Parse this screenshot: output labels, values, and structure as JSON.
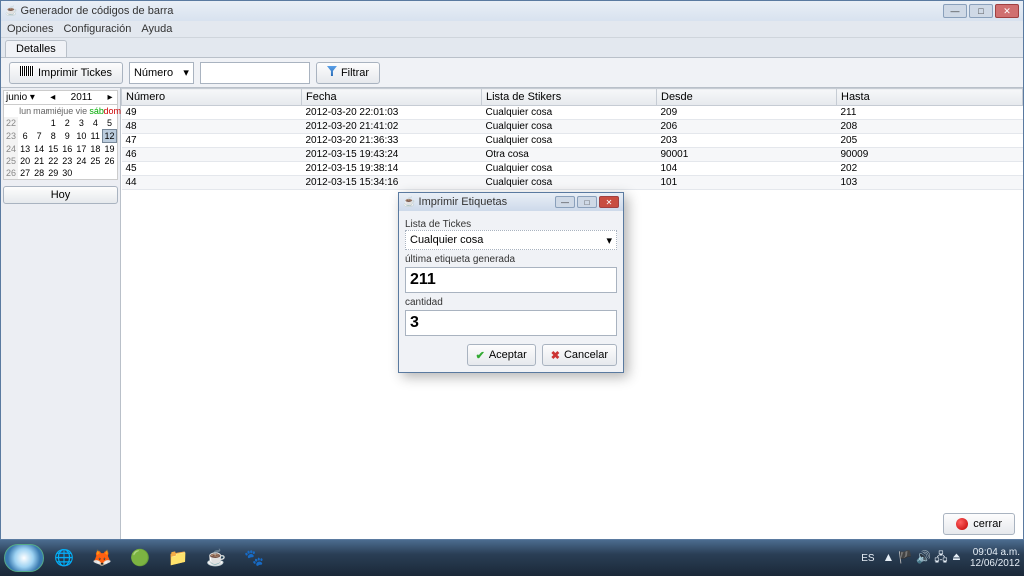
{
  "window": {
    "title": "Generador de códigos de barra"
  },
  "menus": {
    "opciones": "Opciones",
    "config": "Configuración",
    "ayuda": "Ayuda"
  },
  "tabs": {
    "detalles": "Detalles"
  },
  "toolbar": {
    "imprimir": "Imprimir Tickes",
    "filtrar": "Filtrar",
    "combo_label": "Número"
  },
  "calendar": {
    "month": "junio",
    "year": "2011",
    "days": [
      "lun",
      "mar",
      "mié",
      "jue",
      "vie",
      "sáb",
      "dom"
    ],
    "weeks": [
      {
        "wk": "22",
        "d": [
          "",
          "",
          "1",
          "2",
          "3",
          "4",
          "5"
        ]
      },
      {
        "wk": "23",
        "d": [
          "6",
          "7",
          "8",
          "9",
          "10",
          "11",
          "12"
        ]
      },
      {
        "wk": "24",
        "d": [
          "13",
          "14",
          "15",
          "16",
          "17",
          "18",
          "19"
        ]
      },
      {
        "wk": "25",
        "d": [
          "20",
          "21",
          "22",
          "23",
          "24",
          "25",
          "26"
        ]
      },
      {
        "wk": "26",
        "d": [
          "27",
          "28",
          "29",
          "30",
          "",
          "",
          ""
        ]
      }
    ],
    "today_btn": "Hoy"
  },
  "grid": {
    "headers": {
      "numero": "Número",
      "fecha": "Fecha",
      "lista": "Lista de Stikers",
      "desde": "Desde",
      "hasta": "Hasta"
    },
    "rows": [
      {
        "n": "49",
        "f": "2012-03-20 22:01:03",
        "l": "Cualquier cosa",
        "d": "209",
        "h": "211"
      },
      {
        "n": "48",
        "f": "2012-03-20 21:41:02",
        "l": "Cualquier cosa",
        "d": "206",
        "h": "208"
      },
      {
        "n": "47",
        "f": "2012-03-20 21:36:33",
        "l": "Cualquier cosa",
        "d": "203",
        "h": "205"
      },
      {
        "n": "46",
        "f": "2012-03-15 19:43:24",
        "l": "Otra cosa",
        "d": "90001",
        "h": "90009"
      },
      {
        "n": "45",
        "f": "2012-03-15 19:38:14",
        "l": "Cualquier cosa",
        "d": "104",
        "h": "202"
      },
      {
        "n": "44",
        "f": "2012-03-15 15:34:16",
        "l": "Cualquier cosa",
        "d": "101",
        "h": "103"
      }
    ]
  },
  "footer": {
    "cerrar": "cerrar"
  },
  "modal": {
    "title": "Imprimir Etiquetas",
    "label_lista": "Lista de Tickes",
    "combo_value": "Cualquier cosa",
    "label_ultima": "última etiqueta generada",
    "ultima_val": "211",
    "label_cantidad": "cantidad",
    "cantidad_val": "3",
    "aceptar": "Aceptar",
    "cancelar": "Cancelar"
  },
  "taskbar": {
    "lang": "ES",
    "time": "09:04 a.m.",
    "date": "12/06/2012"
  }
}
